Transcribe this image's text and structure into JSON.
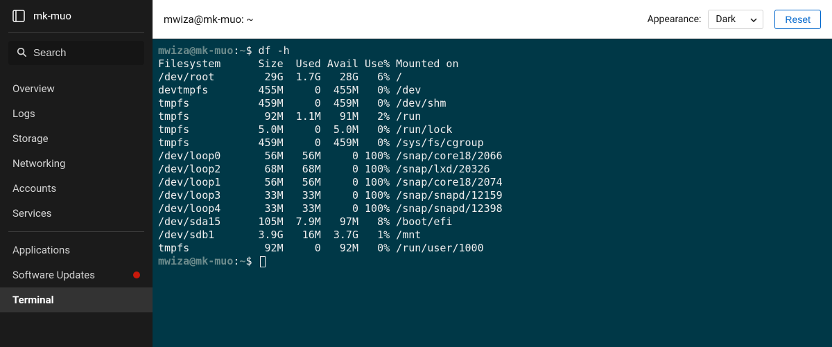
{
  "sidebar": {
    "hostname": "mk-muo",
    "search_placeholder": "Search",
    "groups": [
      [
        {
          "id": "overview",
          "label": "Overview",
          "active": false,
          "badge": false
        },
        {
          "id": "logs",
          "label": "Logs",
          "active": false,
          "badge": false
        },
        {
          "id": "storage",
          "label": "Storage",
          "active": false,
          "badge": false
        },
        {
          "id": "networking",
          "label": "Networking",
          "active": false,
          "badge": false
        },
        {
          "id": "accounts",
          "label": "Accounts",
          "active": false,
          "badge": false
        },
        {
          "id": "services",
          "label": "Services",
          "active": false,
          "badge": false
        }
      ],
      [
        {
          "id": "applications",
          "label": "Applications",
          "active": false,
          "badge": false
        },
        {
          "id": "software-updates",
          "label": "Software Updates",
          "active": false,
          "badge": true
        },
        {
          "id": "terminal",
          "label": "Terminal",
          "active": true,
          "badge": false
        }
      ]
    ]
  },
  "topbar": {
    "title": "mwiza@mk-muo: ~",
    "appearance_label": "Appearance:",
    "appearance_value": "Dark",
    "reset_label": "Reset"
  },
  "terminal": {
    "prompt": {
      "user_host": "mwiza@mk-muo",
      "sep": ":",
      "cwd": "~",
      "sigil": "$"
    },
    "command": "df -h",
    "header": [
      "Filesystem",
      "Size",
      "Used",
      "Avail",
      "Use%",
      "Mounted on"
    ],
    "rows": [
      {
        "fs": "/dev/root",
        "size": "29G",
        "used": "1.7G",
        "avail": "28G",
        "usep": "6%",
        "mount": "/"
      },
      {
        "fs": "devtmpfs",
        "size": "455M",
        "used": "0",
        "avail": "455M",
        "usep": "0%",
        "mount": "/dev"
      },
      {
        "fs": "tmpfs",
        "size": "459M",
        "used": "0",
        "avail": "459M",
        "usep": "0%",
        "mount": "/dev/shm"
      },
      {
        "fs": "tmpfs",
        "size": "92M",
        "used": "1.1M",
        "avail": "91M",
        "usep": "2%",
        "mount": "/run"
      },
      {
        "fs": "tmpfs",
        "size": "5.0M",
        "used": "0",
        "avail": "5.0M",
        "usep": "0%",
        "mount": "/run/lock"
      },
      {
        "fs": "tmpfs",
        "size": "459M",
        "used": "0",
        "avail": "459M",
        "usep": "0%",
        "mount": "/sys/fs/cgroup"
      },
      {
        "fs": "/dev/loop0",
        "size": "56M",
        "used": "56M",
        "avail": "0",
        "usep": "100%",
        "mount": "/snap/core18/2066"
      },
      {
        "fs": "/dev/loop2",
        "size": "68M",
        "used": "68M",
        "avail": "0",
        "usep": "100%",
        "mount": "/snap/lxd/20326"
      },
      {
        "fs": "/dev/loop1",
        "size": "56M",
        "used": "56M",
        "avail": "0",
        "usep": "100%",
        "mount": "/snap/core18/2074"
      },
      {
        "fs": "/dev/loop3",
        "size": "33M",
        "used": "33M",
        "avail": "0",
        "usep": "100%",
        "mount": "/snap/snapd/12159"
      },
      {
        "fs": "/dev/loop4",
        "size": "33M",
        "used": "33M",
        "avail": "0",
        "usep": "100%",
        "mount": "/snap/snapd/12398"
      },
      {
        "fs": "/dev/sda15",
        "size": "105M",
        "used": "7.9M",
        "avail": "97M",
        "usep": "8%",
        "mount": "/boot/efi"
      },
      {
        "fs": "/dev/sdb1",
        "size": "3.9G",
        "used": "16M",
        "avail": "3.7G",
        "usep": "1%",
        "mount": "/mnt"
      },
      {
        "fs": "tmpfs",
        "size": "92M",
        "used": "0",
        "avail": "92M",
        "usep": "0%",
        "mount": "/run/user/1000"
      }
    ]
  }
}
